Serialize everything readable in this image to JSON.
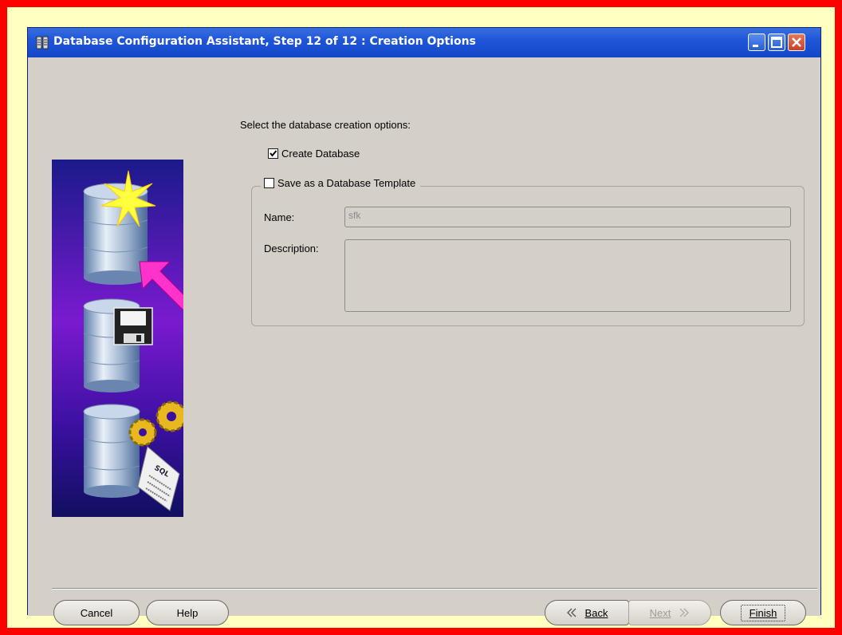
{
  "window": {
    "title": "Database Configuration Assistant, Step 12 of 12 : Creation Options"
  },
  "main": {
    "prompt": "Select the database creation options:",
    "create_database": {
      "label": "Create Database",
      "checked": true
    },
    "save_template": {
      "label": "Save as a Database Template",
      "checked": false,
      "name_label": "Name:",
      "name_value": "sfk",
      "description_label": "Description:",
      "description_value": ""
    }
  },
  "footer": {
    "cancel": "Cancel",
    "help": "Help",
    "back": "Back",
    "next": "Next",
    "finish": "Finish"
  },
  "icons": [
    "window-app-icon",
    "minimize-icon",
    "maximize-icon",
    "close-icon",
    "database-creation-illustration",
    "back-arrow-icon",
    "next-arrow-icon"
  ],
  "colors": {
    "outer_border": "#ff0000",
    "outer_fill": "#ffffc0",
    "titlebar": "#1f56d8",
    "dialog_bg": "#d4d0c8",
    "arrow": "#ff33cc"
  }
}
